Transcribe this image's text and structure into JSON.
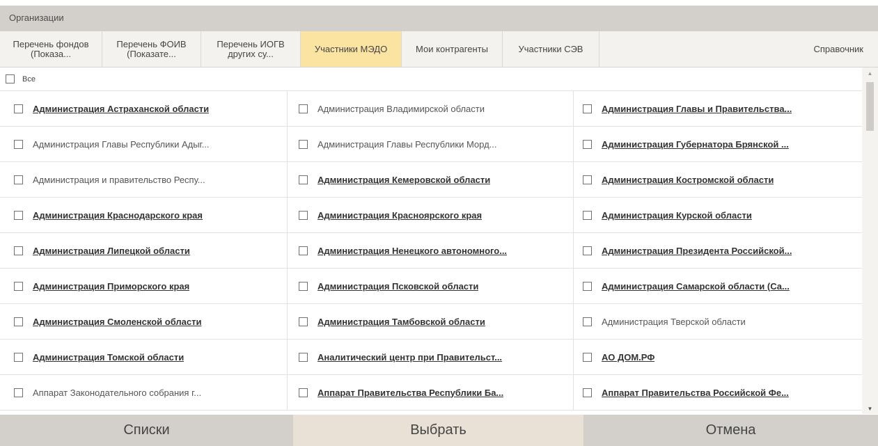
{
  "window": {
    "title": "Организации"
  },
  "tabs": [
    {
      "label": "Перечень фондов\n(Показа...",
      "active": false
    },
    {
      "label": "Перечень ФОИВ\n(Показате...",
      "active": false
    },
    {
      "label": "Перечень ИОГВ\nдругих су...",
      "active": false
    },
    {
      "label": "Участники МЭДО",
      "active": true
    },
    {
      "label": "Мои контрагенты",
      "active": false
    },
    {
      "label": "Участники СЭВ",
      "active": false
    },
    {
      "label": "Справочник",
      "active": false
    }
  ],
  "select_all": {
    "label": "Все",
    "checked": false
  },
  "organizations": [
    {
      "label": "Администрация Астраханской области",
      "bold": true
    },
    {
      "label": "Администрация Владимирской области",
      "bold": false
    },
    {
      "label": "Администрация Главы и Правительства...",
      "bold": true
    },
    {
      "label": "Администрация Главы Республики Адыг...",
      "bold": false
    },
    {
      "label": "Администрация Главы Республики Морд...",
      "bold": false
    },
    {
      "label": "Администрация Губернатора Брянской ...",
      "bold": true
    },
    {
      "label": "Администрация и правительство Респу...",
      "bold": false
    },
    {
      "label": "Администрация Кемеровской области",
      "bold": true
    },
    {
      "label": "Администрация Костромской области",
      "bold": true
    },
    {
      "label": "Администрация Краснодарского края",
      "bold": true
    },
    {
      "label": "Администрация Красноярского края",
      "bold": true
    },
    {
      "label": "Администрация Курской области",
      "bold": true
    },
    {
      "label": "Администрация Липецкой области",
      "bold": true
    },
    {
      "label": "Администрация Ненецкого автономного...",
      "bold": true
    },
    {
      "label": "Администрация Президента Российской...",
      "bold": true
    },
    {
      "label": "Администрация Приморского края",
      "bold": true
    },
    {
      "label": "Администрация Псковской области",
      "bold": true
    },
    {
      "label": "Администрация Самарской области (Са...",
      "bold": true
    },
    {
      "label": "Администрация Смоленской области",
      "bold": true
    },
    {
      "label": "Администрация Тамбовской области",
      "bold": true
    },
    {
      "label": "Администрация Тверской области",
      "bold": false
    },
    {
      "label": "Администрация Томской области",
      "bold": true
    },
    {
      "label": "Аналитический центр при Правительст...",
      "bold": true
    },
    {
      "label": "АО ДОМ.РФ",
      "bold": true
    },
    {
      "label": "Аппарат Законодательного собрания г...",
      "bold": false
    },
    {
      "label": "Аппарат Правительства Республики Ба...",
      "bold": true
    },
    {
      "label": "Аппарат Правительства Российской Фе...",
      "bold": true
    }
  ],
  "footer": {
    "lists_label": "Списки",
    "select_label": "Выбрать",
    "cancel_label": "Отмена"
  },
  "colors": {
    "titlebar": "#d3cfca",
    "active_tab": "#fbe3a1",
    "select_button": "#e9e0d6"
  }
}
